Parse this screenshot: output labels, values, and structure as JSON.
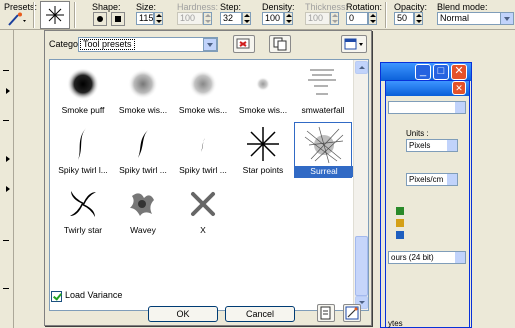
{
  "toolbar": {
    "presets_label": "Presets:",
    "shape_label": "Shape:",
    "size_label": "Size:",
    "size_value": "115",
    "hardness_label": "Hardness:",
    "hardness_value": "100",
    "step_label": "Step:",
    "step_value": "32",
    "density_label": "Density:",
    "density_value": "100",
    "thickness_label": "Thickness:",
    "thickness_value": "100",
    "rotation_label": "Rotation:",
    "rotation_value": "0",
    "opacity_label": "Opacity:",
    "opacity_value": "50",
    "blend_label": "Blend mode:",
    "blend_value": "Normal"
  },
  "background": {
    "units_label": "Units :",
    "units_value": "Pixels",
    "res_value": "Pixels/cm",
    "color_value": "ours (24 bit)",
    "bottom_text": "ytes"
  },
  "popup": {
    "category_label": "Catego",
    "category_value": "Tool presets",
    "presets": [
      {
        "name": "Smoke puff",
        "icon": "smoke-puff-brush-icon"
      },
      {
        "name": "Smoke wis...",
        "icon": "smoke-wisp-brush-icon"
      },
      {
        "name": "Smoke wis...",
        "icon": "smoke-wisp-brush-icon"
      },
      {
        "name": "Smoke wis...",
        "icon": "smoke-wisp-brush-icon"
      },
      {
        "name": "smwaterfall",
        "icon": "smwaterfall-brush-icon"
      },
      {
        "name": "Spiky twirl l...",
        "icon": "spiky-twirl-brush-icon"
      },
      {
        "name": "Spiky twirl ...",
        "icon": "spiky-twirl-brush-icon"
      },
      {
        "name": "Spiky twirl ...",
        "icon": "spiky-twirl-brush-icon"
      },
      {
        "name": "Star points",
        "icon": "star-points-brush-icon"
      },
      {
        "name": "Surreal",
        "icon": "surreal-brush-icon",
        "selected": true
      },
      {
        "name": "Twirly star",
        "icon": "twirly-star-brush-icon"
      },
      {
        "name": "Wavey",
        "icon": "wavey-brush-icon"
      },
      {
        "name": "X",
        "icon": "x-brush-icon"
      }
    ],
    "load_variance_label": "Load Variance",
    "ok_label": "OK",
    "cancel_label": "Cancel"
  },
  "colors": {
    "selection": "#316ac5",
    "xp_title": "#0a5fd8",
    "close_button": "#e4522a"
  }
}
